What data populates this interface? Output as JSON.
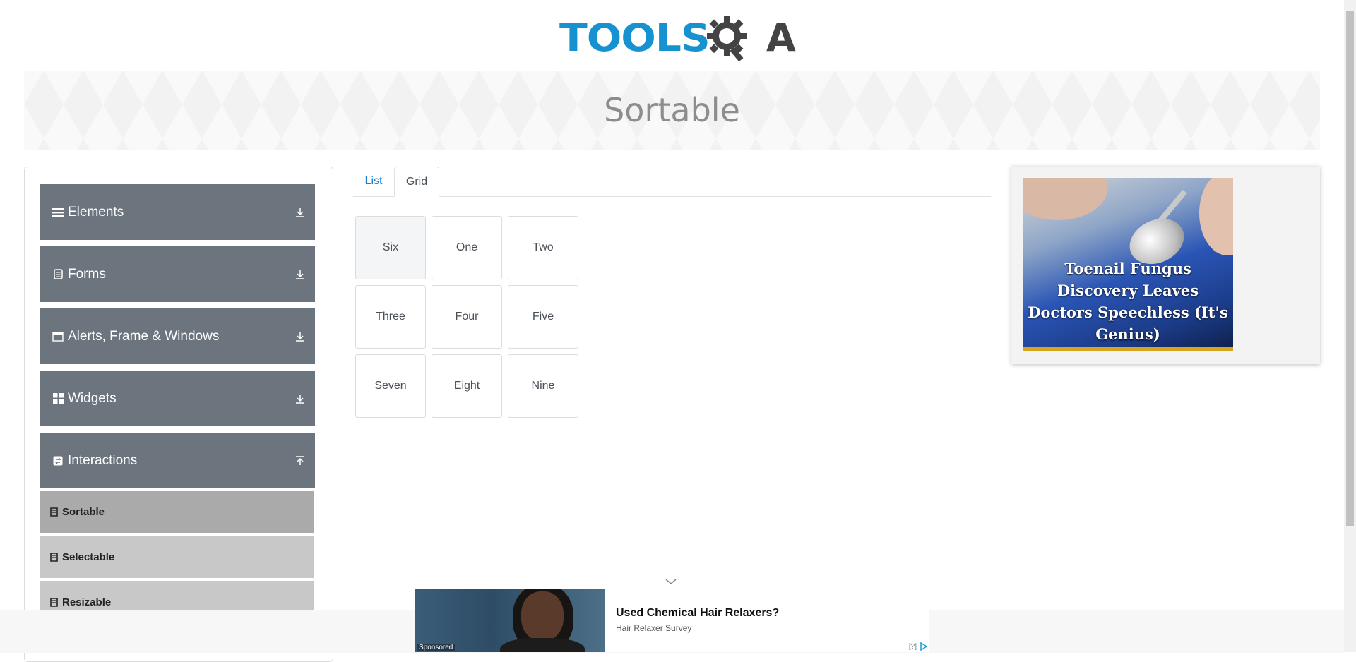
{
  "header": {
    "logo_tools": "TOOLS",
    "logo_qa": "A",
    "page_title": "Sortable"
  },
  "sidebar": {
    "groups": [
      {
        "label": "Elements",
        "icon": "hamburger-icon",
        "expanded": false
      },
      {
        "label": "Forms",
        "icon": "form-icon",
        "expanded": false
      },
      {
        "label": "Alerts, Frame & Windows",
        "icon": "window-icon",
        "expanded": false
      },
      {
        "label": "Widgets",
        "icon": "widgets-icon",
        "expanded": false
      },
      {
        "label": "Interactions",
        "icon": "interactions-icon",
        "expanded": true
      }
    ],
    "sub_items": [
      {
        "label": "Sortable",
        "active": true
      },
      {
        "label": "Selectable",
        "active": false
      },
      {
        "label": "Resizable",
        "active": false
      }
    ]
  },
  "tabs": [
    {
      "label": "List",
      "active": false
    },
    {
      "label": "Grid",
      "active": true
    }
  ],
  "grid": {
    "items": [
      "Six",
      "One",
      "Two",
      "Three",
      "Four",
      "Five",
      "Seven",
      "Eight",
      "Nine"
    ]
  },
  "ad_right": {
    "caption": "Toenail Fungus Discovery Leaves Doctors Speechless (It's Genius)"
  },
  "ad_bottom": {
    "title": "Used Chemical Hair Relaxers?",
    "subtitle": "Hair Relaxer Survey",
    "sponsored": "Sponsored",
    "help": "[?]"
  },
  "colors": {
    "brand_blue": "#1692d0",
    "sidebar_group": "#6c757d",
    "sidebar_active": "#aaaaaa",
    "sidebar_sub": "#c8c8c8"
  }
}
